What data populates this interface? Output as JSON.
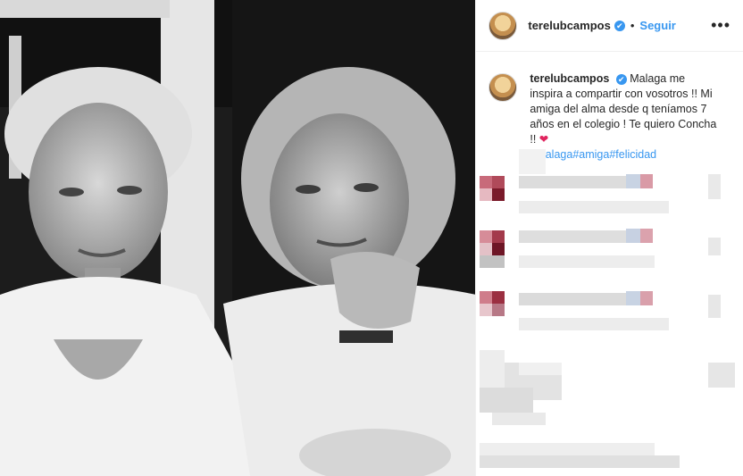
{
  "post": {
    "username": "terelubcampos",
    "verified_glyph": "✔",
    "separator": "•",
    "follow_label": "Seguir",
    "more_glyph": "•••",
    "caption_user": "terelubcampos",
    "caption_text": "Malaga me inspira a compartir con vosotros !! Mi amiga del alma desde q teníamos 7 años en el colegio ! Te quiero Concha !!",
    "heart_glyph": "❤",
    "hashtags": [
      "#malaga",
      "#amiga",
      "#felicidad"
    ]
  },
  "icons": [
    "avatar-image",
    "verified-icon",
    "more-options-icon",
    "heart-emoji"
  ],
  "colors": {
    "link": "#3897f0",
    "text": "#262626",
    "heart": "#e0245e",
    "border": "#efefef"
  }
}
